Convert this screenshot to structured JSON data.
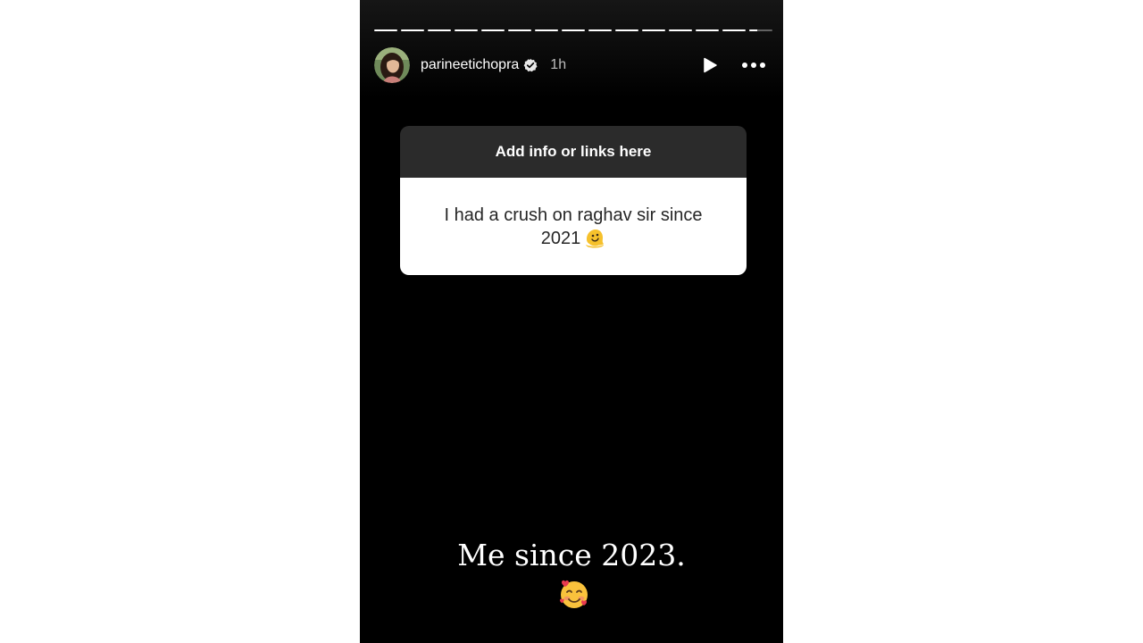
{
  "story": {
    "username": "parineetichopra",
    "verified": true,
    "time_ago": "1h",
    "progress": {
      "segments": 15,
      "completed": 14,
      "current_fraction": 0.35
    },
    "controls": {
      "play_icon": "play-icon",
      "more_icon": "more-horizontal-icon"
    },
    "question_box": {
      "header": "Add info or links here",
      "answer": "I had a crush on raghav sir since 2021",
      "answer_emoji": "melting-face-emoji"
    },
    "caption": {
      "text": "Me since 2023.",
      "emoji": "smiling-face-with-hearts-emoji"
    }
  }
}
